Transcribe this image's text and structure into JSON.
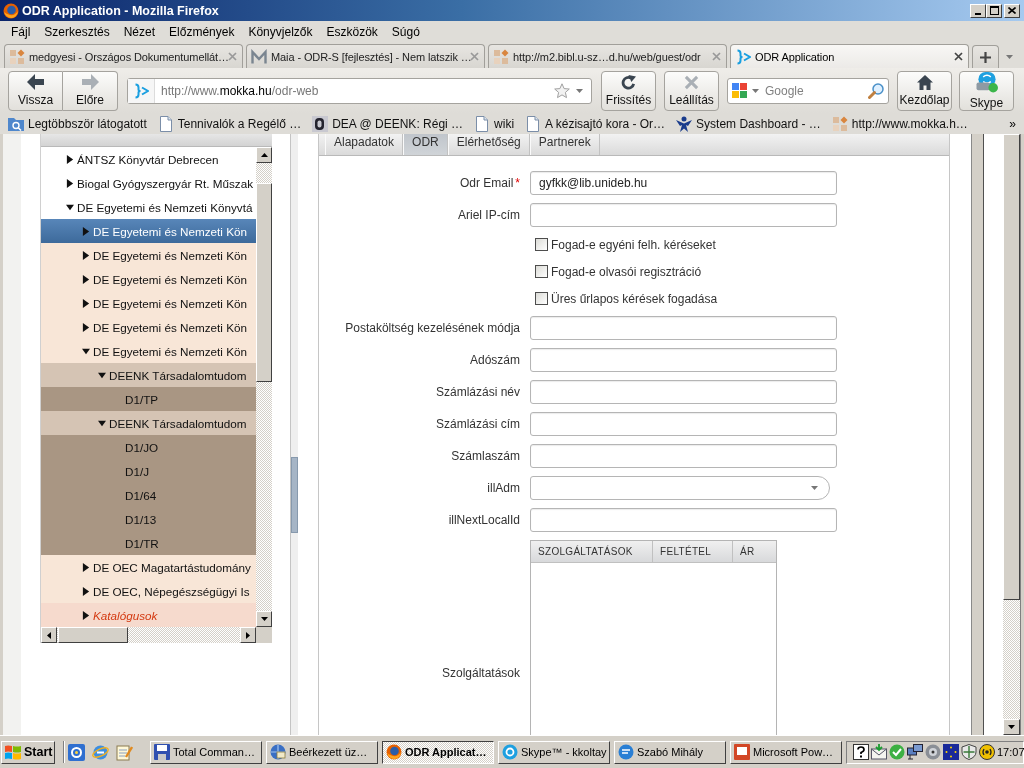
{
  "window": {
    "title": "ODR Application - Mozilla Firefox"
  },
  "menu": [
    "Fájl",
    "Szerkesztés",
    "Nézet",
    "Előzmények",
    "Könyvjelzők",
    "Eszközök",
    "Súgó"
  ],
  "browser_tabs": [
    {
      "title": "medgyesi - Országos Dokumentumellát…",
      "kind": "grid",
      "selected": false
    },
    {
      "title": "Maia - ODR-S [fejlesztés] - Nem latszik …",
      "kind": "zigzag",
      "selected": false
    },
    {
      "title": "http://m2.bibl.u-sz…d.hu/web/guest/odr",
      "kind": "grid",
      "selected": false
    },
    {
      "title": "ODR Application",
      "kind": "brace",
      "selected": true
    }
  ],
  "toolbar": {
    "history_buttons": [
      {
        "label": "Vissza",
        "kind": "back",
        "disabled": false
      },
      {
        "label": "Előre",
        "kind": "forward",
        "disabled": true
      }
    ],
    "address": {
      "parts": [
        {
          "text": "http://www.",
          "emphasis": false
        },
        {
          "text": "mokka.hu",
          "emphasis": true
        },
        {
          "text": "/odr-web",
          "emphasis": false
        }
      ]
    },
    "page_buttons": [
      {
        "label": "Frissítés",
        "kind": "reload",
        "disabled": false
      },
      {
        "label": "Leállítás",
        "kind": "stop",
        "disabled": true
      }
    ],
    "search": {
      "placeholder": "Google"
    },
    "extra_buttons": [
      {
        "label": "Kezdőlap",
        "kind": "home",
        "disabled": false
      },
      {
        "label": "Skype",
        "kind": "skype",
        "disabled": false
      }
    ]
  },
  "bookmarks": {
    "items": [
      {
        "label": "Legtöbbször látogatott",
        "kind": "folder"
      },
      {
        "label": "Tennivalók a Regélő …",
        "kind": "page"
      },
      {
        "label": "DEA @ DEENK: Régi …",
        "kind": "tile"
      },
      {
        "label": "wiki",
        "kind": "page"
      },
      {
        "label": "A kézisajtó kora - Or…",
        "kind": "page"
      },
      {
        "label": "System Dashboard - …",
        "kind": "figure"
      },
      {
        "label": "http://www.mokka.h…",
        "kind": "grid"
      }
    ],
    "overflow": "»"
  },
  "tree": {
    "items": [
      {
        "label": "ÁNTSZ Könyvtár Debrecen",
        "kind": "node",
        "expanded": false,
        "selected": false
      },
      {
        "label": "Biogal Gyógyszergyár Rt. Műszak",
        "kind": "node",
        "expanded": false,
        "selected": false
      },
      {
        "label": "DE Egyetemi és Nemzeti Könyvtá",
        "kind": "node",
        "expanded": true,
        "selected": false,
        "children": [
          {
            "label": "DE Egyetemi és Nemzeti Kön",
            "kind": "node",
            "expanded": false,
            "selected": true
          },
          {
            "label": "DE Egyetemi és Nemzeti Kön",
            "kind": "node",
            "expanded": false,
            "selected": false
          },
          {
            "label": "DE Egyetemi és Nemzeti Kön",
            "kind": "node",
            "expanded": false,
            "selected": false
          },
          {
            "label": "DE Egyetemi és Nemzeti Kön",
            "kind": "node",
            "expanded": false,
            "selected": false
          },
          {
            "label": "DE Egyetemi és Nemzeti Kön",
            "kind": "node",
            "expanded": false,
            "selected": false
          },
          {
            "label": "DE Egyetemi és Nemzeti Kön",
            "kind": "node",
            "expanded": true,
            "selected": false,
            "children": [
              {
                "label": "DEENK Társadalomtudom",
                "kind": "node",
                "expanded": true,
                "selected": false,
                "children": [
                  {
                    "label": "D1/TP",
                    "kind": "leaf",
                    "selected": false
                  }
                ]
              },
              {
                "label": "DEENK Társadalomtudom",
                "kind": "node",
                "expanded": true,
                "selected": false,
                "children": [
                  {
                    "label": "D1/JO",
                    "kind": "leaf",
                    "selected": false
                  },
                  {
                    "label": "D1/J",
                    "kind": "leaf",
                    "selected": false
                  },
                  {
                    "label": "D1/64",
                    "kind": "leaf",
                    "selected": false
                  },
                  {
                    "label": "D1/13",
                    "kind": "leaf",
                    "selected": false
                  },
                  {
                    "label": "D1/TR",
                    "kind": "leaf",
                    "selected": false
                  }
                ]
              }
            ]
          },
          {
            "label": "DE OEC Magatartástudomány",
            "kind": "node",
            "expanded": false,
            "selected": false
          },
          {
            "label": "DE OEC, Népegészségügyi Is",
            "kind": "node",
            "expanded": false,
            "selected": false
          },
          {
            "label": "Katalógusok",
            "kind": "catalog",
            "expanded": false,
            "selected": false
          }
        ]
      }
    ]
  },
  "form": {
    "tabs": [
      {
        "label": "Alapadatok",
        "selected": false
      },
      {
        "label": "ODR",
        "selected": true
      },
      {
        "label": "Elérhetőség",
        "selected": false
      },
      {
        "label": "Partnerek",
        "selected": false
      }
    ],
    "fields": [
      {
        "kind": "text",
        "label": "Odr Email",
        "required_mark": "*",
        "value": "gyfkk@lib.unideb.hu"
      },
      {
        "kind": "text",
        "label": "Ariel IP-cím"
      },
      {
        "kind": "checkbox",
        "label": "Fogad-e egyéni felh. kéréseket",
        "checked": false
      },
      {
        "kind": "checkbox",
        "label": "Fogad-e olvasói regisztráció",
        "checked": false
      },
      {
        "kind": "checkbox",
        "label": "Üres űrlapos kérések fogadása",
        "checked": false
      },
      {
        "kind": "text",
        "label": "Postaköltség kezelésének módja"
      },
      {
        "kind": "text",
        "label": "Adószám"
      },
      {
        "kind": "text",
        "label": "Számlázási név"
      },
      {
        "kind": "text",
        "label": "Számlázási cím"
      },
      {
        "kind": "text",
        "label": "Számlaszám"
      },
      {
        "kind": "select",
        "label": "illAdm"
      },
      {
        "kind": "text",
        "label": "illNextLocalId"
      },
      {
        "kind": "table",
        "label": "Szolgáltatások",
        "columns": [
          "SZOLGÁLTATÁSOK",
          "FELTÉTEL",
          "ÁR"
        ]
      }
    ]
  },
  "taskbar": {
    "start": "Start",
    "tasks": [
      {
        "label": "Total Comman…",
        "kind": "floppy",
        "selected": false
      },
      {
        "label": "Beérkezett üz…",
        "kind": "mail",
        "selected": false
      },
      {
        "label": "ODR Applicat…",
        "kind": "firefox",
        "selected": true
      },
      {
        "label": "Skype™ - kkoltay",
        "kind": "skype",
        "selected": false
      },
      {
        "label": "Szabó Mihály",
        "kind": "chat",
        "selected": false
      },
      {
        "label": "Microsoft Pow…",
        "kind": "slides",
        "selected": false
      }
    ],
    "clock": "17:07"
  }
}
